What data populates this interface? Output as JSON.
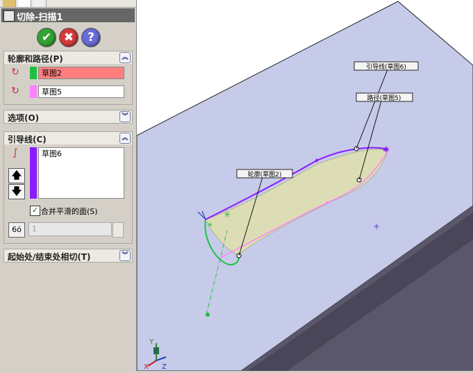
{
  "window": {
    "title": "切除-扫描1"
  },
  "actions": {
    "ok_icon": "check-icon",
    "cancel_icon": "x-icon",
    "help_icon": "question-icon"
  },
  "sections": {
    "profile_path": {
      "header": "轮廓和路径(P)",
      "profile_value": "草图2",
      "path_value": "草图5",
      "profile_color": "#ff7f7f",
      "profile_swatch": "#1fbf3f",
      "path_swatch": "#ff80ff"
    },
    "options": {
      "header": "选项(O)"
    },
    "guide": {
      "header": "引导线(C)",
      "items": [
        "草图6"
      ],
      "swatch": "#8a1cff",
      "merge_label": "合并平滑的面(S)",
      "merge_checked": true,
      "count_value": "1"
    },
    "tangency": {
      "header": "起始处/结束处相切(T)"
    }
  },
  "callouts": {
    "guide": "引导线(草图6)",
    "path": "路径(草图5)",
    "profile": "轮廓(草图2)"
  },
  "axes": {
    "x": "X",
    "y": "Y",
    "z": "Z"
  },
  "colors": {
    "panel_bg": "#d4d0c8",
    "plane": "#c6cbe9",
    "block_side": "#5b576b",
    "cut_fill": "#dcddb4",
    "guide": "#8a1cff",
    "path": "#ff80ff",
    "profile": "#1fbf3f"
  }
}
